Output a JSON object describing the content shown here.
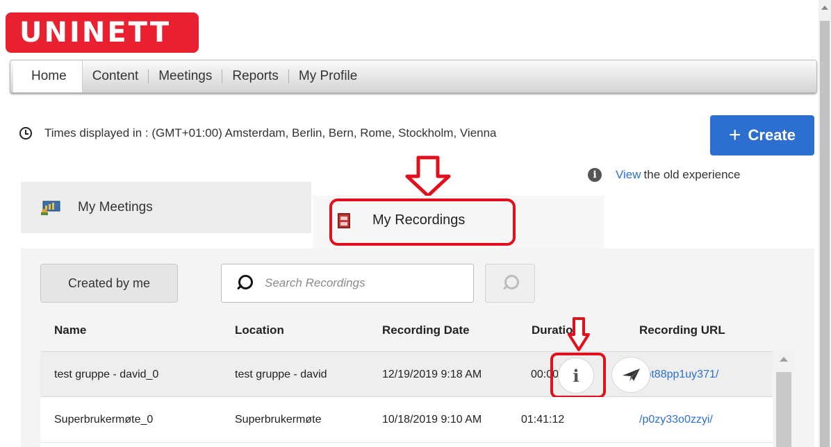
{
  "logo": {
    "text": "UNINETT"
  },
  "nav": {
    "items": [
      {
        "label": "Home"
      },
      {
        "label": "Content"
      },
      {
        "label": "Meetings"
      },
      {
        "label": "Reports"
      },
      {
        "label": "My Profile"
      }
    ]
  },
  "timezone": {
    "text": "Times displayed in : (GMT+01:00) Amsterdam, Berlin, Bern, Rome, Stockholm, Vienna",
    "icon": "clock-icon"
  },
  "create_button": {
    "label": "Create",
    "icon": "plus-icon"
  },
  "old_experience": {
    "link": "View",
    "text": "the old experience",
    "icon": "info-icon"
  },
  "tabs": {
    "meetings": {
      "label": "My Meetings",
      "icon": "meetings-icon"
    },
    "recordings": {
      "label": "My Recordings",
      "icon": "film-icon"
    }
  },
  "filters": {
    "created_by_me": "Created by me",
    "search_placeholder": "Search Recordings"
  },
  "table": {
    "headers": [
      "Name",
      "Location",
      "Recording Date",
      "Duration",
      "Recording URL"
    ],
    "rows": [
      {
        "name": "test gruppe - david_0",
        "location": "test gruppe - david",
        "date": "12/19/2019 9:18 AM",
        "duration": "00:00:28",
        "url": "/pt88pp1uy371/"
      },
      {
        "name": "Superbrukermøte_0",
        "location": "Superbrukermøte",
        "date": "10/18/2019 9:10 AM",
        "duration": "01:41:12",
        "url": "/p0zy33o0zzyi/"
      }
    ]
  },
  "colors": {
    "brand_red": "#e8202f",
    "primary_blue": "#2c6fd0",
    "annotation_red": "#e0101c"
  }
}
